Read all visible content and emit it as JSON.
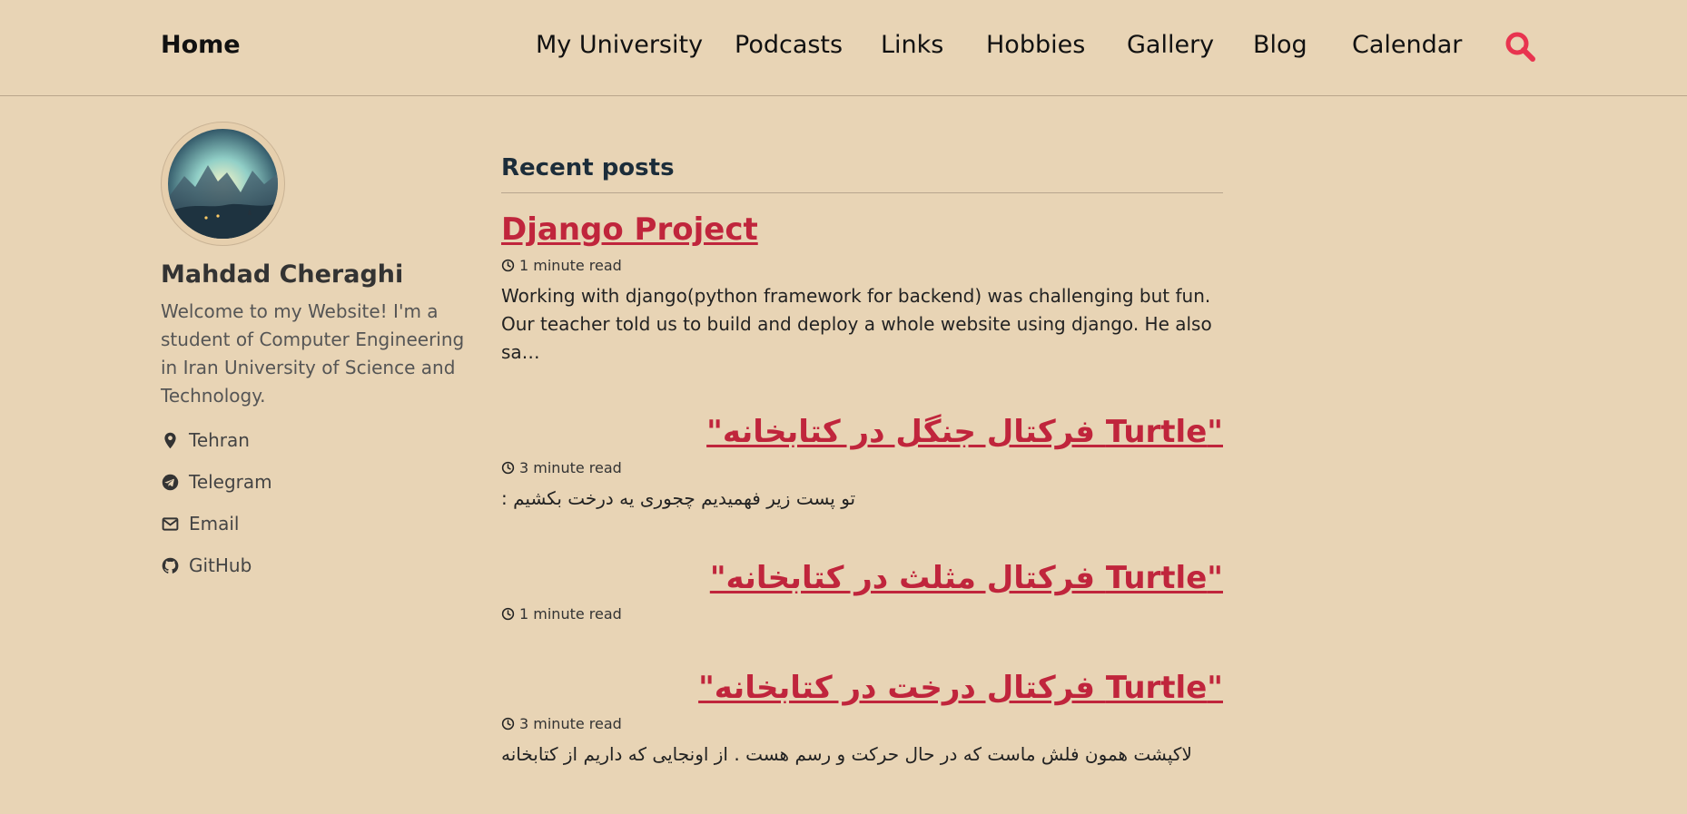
{
  "header": {
    "brand": "Home",
    "nav": [
      {
        "label": "My University"
      },
      {
        "label": "Podcasts"
      },
      {
        "label": "Links"
      },
      {
        "label": "Hobbies"
      },
      {
        "label": "Gallery"
      },
      {
        "label": "Blog"
      },
      {
        "label": "Calendar"
      }
    ],
    "search_icon": "search-icon",
    "search_color": "#e8344f"
  },
  "sidebar": {
    "name": "Mahdad Cheraghi",
    "bio": "Welcome to my Website! I'm a student of Computer Engineering in Iran University of Science and Technology.",
    "links": [
      {
        "label": "Tehran",
        "icon": "location-pin-icon"
      },
      {
        "label": "Telegram",
        "icon": "telegram-icon"
      },
      {
        "label": "Email",
        "icon": "email-icon"
      },
      {
        "label": "GitHub",
        "icon": "github-icon"
      }
    ]
  },
  "main": {
    "section_title": "Recent posts",
    "posts": [
      {
        "title": "Django Project",
        "read_time": "1 minute read",
        "excerpt": "Working with django(python framework for backend) was challenging but fun. Our teacher told us to build and deploy a whole website using django. He also sa…"
      },
      {
        "title": "\"Turtle فرکتال جنگل در کتابخانه\"",
        "read_time": "3 minute read",
        "excerpt": "تو پست زیر فهمیدیم چجوری یه درخت بکشیم :"
      },
      {
        "title": "\"Turtle فرکتال مثلث در کتابخانه\"",
        "read_time": "1 minute read",
        "excerpt": ""
      },
      {
        "title": "\"Turtle فرکتال درخت در کتابخانه\"",
        "read_time": "3 minute read",
        "excerpt": "لاکپشت همون فلش ماست که در حال حرکت و رسم هست . از اونجایی که داریم از کتابخانه"
      }
    ]
  },
  "colors": {
    "background": "#e8d4b5",
    "link": "#c0253c",
    "title": "#1c2d3a"
  }
}
